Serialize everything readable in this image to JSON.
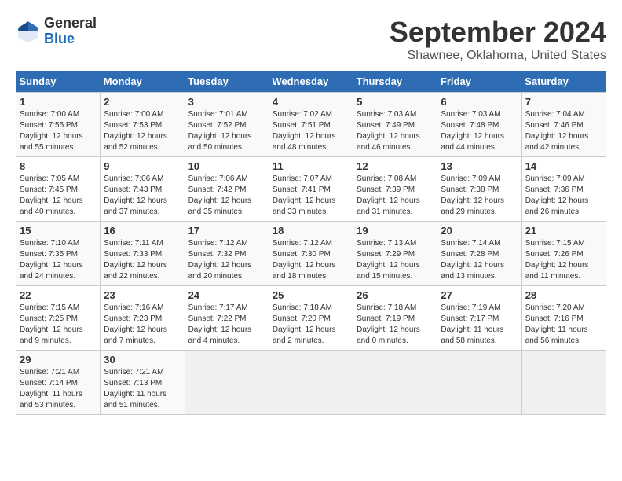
{
  "header": {
    "logo_general": "General",
    "logo_blue": "Blue",
    "month": "September 2024",
    "location": "Shawnee, Oklahoma, United States"
  },
  "calendar": {
    "days_of_week": [
      "Sunday",
      "Monday",
      "Tuesday",
      "Wednesday",
      "Thursday",
      "Friday",
      "Saturday"
    ],
    "weeks": [
      [
        {
          "day": "",
          "empty": true
        },
        {
          "day": "",
          "empty": true
        },
        {
          "day": "",
          "empty": true
        },
        {
          "day": "",
          "empty": true
        },
        {
          "day": "",
          "empty": true
        },
        {
          "day": "",
          "empty": true
        },
        {
          "day": "",
          "empty": true
        }
      ],
      [
        {
          "day": "1",
          "sunrise": "7:00 AM",
          "sunset": "7:55 PM",
          "daylight": "12 hours and 55 minutes."
        },
        {
          "day": "2",
          "sunrise": "7:00 AM",
          "sunset": "7:53 PM",
          "daylight": "12 hours and 52 minutes."
        },
        {
          "day": "3",
          "sunrise": "7:01 AM",
          "sunset": "7:52 PM",
          "daylight": "12 hours and 50 minutes."
        },
        {
          "day": "4",
          "sunrise": "7:02 AM",
          "sunset": "7:51 PM",
          "daylight": "12 hours and 48 minutes."
        },
        {
          "day": "5",
          "sunrise": "7:03 AM",
          "sunset": "7:49 PM",
          "daylight": "12 hours and 46 minutes."
        },
        {
          "day": "6",
          "sunrise": "7:03 AM",
          "sunset": "7:48 PM",
          "daylight": "12 hours and 44 minutes."
        },
        {
          "day": "7",
          "sunrise": "7:04 AM",
          "sunset": "7:46 PM",
          "daylight": "12 hours and 42 minutes."
        }
      ],
      [
        {
          "day": "8",
          "sunrise": "7:05 AM",
          "sunset": "7:45 PM",
          "daylight": "12 hours and 40 minutes."
        },
        {
          "day": "9",
          "sunrise": "7:06 AM",
          "sunset": "7:43 PM",
          "daylight": "12 hours and 37 minutes."
        },
        {
          "day": "10",
          "sunrise": "7:06 AM",
          "sunset": "7:42 PM",
          "daylight": "12 hours and 35 minutes."
        },
        {
          "day": "11",
          "sunrise": "7:07 AM",
          "sunset": "7:41 PM",
          "daylight": "12 hours and 33 minutes."
        },
        {
          "day": "12",
          "sunrise": "7:08 AM",
          "sunset": "7:39 PM",
          "daylight": "12 hours and 31 minutes."
        },
        {
          "day": "13",
          "sunrise": "7:09 AM",
          "sunset": "7:38 PM",
          "daylight": "12 hours and 29 minutes."
        },
        {
          "day": "14",
          "sunrise": "7:09 AM",
          "sunset": "7:36 PM",
          "daylight": "12 hours and 26 minutes."
        }
      ],
      [
        {
          "day": "15",
          "sunrise": "7:10 AM",
          "sunset": "7:35 PM",
          "daylight": "12 hours and 24 minutes."
        },
        {
          "day": "16",
          "sunrise": "7:11 AM",
          "sunset": "7:33 PM",
          "daylight": "12 hours and 22 minutes."
        },
        {
          "day": "17",
          "sunrise": "7:12 AM",
          "sunset": "7:32 PM",
          "daylight": "12 hours and 20 minutes."
        },
        {
          "day": "18",
          "sunrise": "7:12 AM",
          "sunset": "7:30 PM",
          "daylight": "12 hours and 18 minutes."
        },
        {
          "day": "19",
          "sunrise": "7:13 AM",
          "sunset": "7:29 PM",
          "daylight": "12 hours and 15 minutes."
        },
        {
          "day": "20",
          "sunrise": "7:14 AM",
          "sunset": "7:28 PM",
          "daylight": "12 hours and 13 minutes."
        },
        {
          "day": "21",
          "sunrise": "7:15 AM",
          "sunset": "7:26 PM",
          "daylight": "12 hours and 11 minutes."
        }
      ],
      [
        {
          "day": "22",
          "sunrise": "7:15 AM",
          "sunset": "7:25 PM",
          "daylight": "12 hours and 9 minutes."
        },
        {
          "day": "23",
          "sunrise": "7:16 AM",
          "sunset": "7:23 PM",
          "daylight": "12 hours and 7 minutes."
        },
        {
          "day": "24",
          "sunrise": "7:17 AM",
          "sunset": "7:22 PM",
          "daylight": "12 hours and 4 minutes."
        },
        {
          "day": "25",
          "sunrise": "7:18 AM",
          "sunset": "7:20 PM",
          "daylight": "12 hours and 2 minutes."
        },
        {
          "day": "26",
          "sunrise": "7:18 AM",
          "sunset": "7:19 PM",
          "daylight": "12 hours and 0 minutes."
        },
        {
          "day": "27",
          "sunrise": "7:19 AM",
          "sunset": "7:17 PM",
          "daylight": "11 hours and 58 minutes."
        },
        {
          "day": "28",
          "sunrise": "7:20 AM",
          "sunset": "7:16 PM",
          "daylight": "11 hours and 56 minutes."
        }
      ],
      [
        {
          "day": "29",
          "sunrise": "7:21 AM",
          "sunset": "7:14 PM",
          "daylight": "11 hours and 53 minutes."
        },
        {
          "day": "30",
          "sunrise": "7:21 AM",
          "sunset": "7:13 PM",
          "daylight": "11 hours and 51 minutes."
        },
        {
          "day": "",
          "empty": true
        },
        {
          "day": "",
          "empty": true
        },
        {
          "day": "",
          "empty": true
        },
        {
          "day": "",
          "empty": true
        },
        {
          "day": "",
          "empty": true
        }
      ]
    ]
  }
}
